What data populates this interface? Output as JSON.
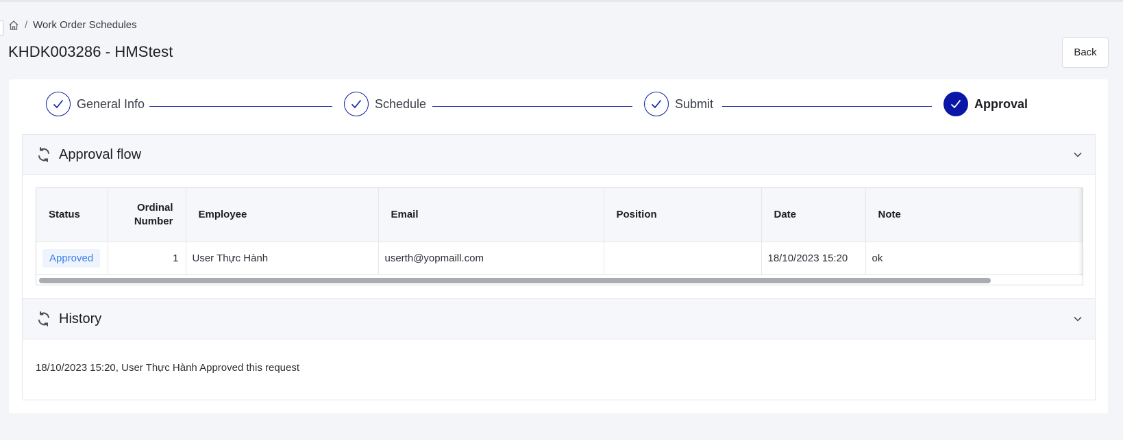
{
  "breadcrumb": {
    "home_icon": "home-icon",
    "separator": "/",
    "current": "Work Order Schedules"
  },
  "page": {
    "title": "KHDK003286 - HMStest",
    "back_label": "Back"
  },
  "stepper": {
    "steps": [
      {
        "label": "General Info",
        "state": "completed"
      },
      {
        "label": "Schedule",
        "state": "completed"
      },
      {
        "label": "Submit",
        "state": "completed"
      },
      {
        "label": "Approval",
        "state": "active"
      }
    ],
    "accent": "#0a16a8"
  },
  "approval_flow": {
    "title": "Approval flow",
    "icon": "sync-icon",
    "columns": [
      "Status",
      "Ordinal Number",
      "Employee",
      "Email",
      "Position",
      "Date",
      "Note"
    ],
    "rows": [
      {
        "status": "Approved",
        "ordinal": "1",
        "employee": "User Thực Hành",
        "email": "userth@yopmaill.com",
        "position": "",
        "date": "18/10/2023 15:20",
        "note": "ok"
      }
    ]
  },
  "history": {
    "title": "History",
    "icon": "sync-icon",
    "entries": [
      "18/10/2023 15:20, User Thực Hành Approved this request"
    ]
  },
  "colors": {
    "badge_bg": "#eef4fe",
    "badge_text": "#3b7de8",
    "step_line": "#1a2a9a"
  }
}
